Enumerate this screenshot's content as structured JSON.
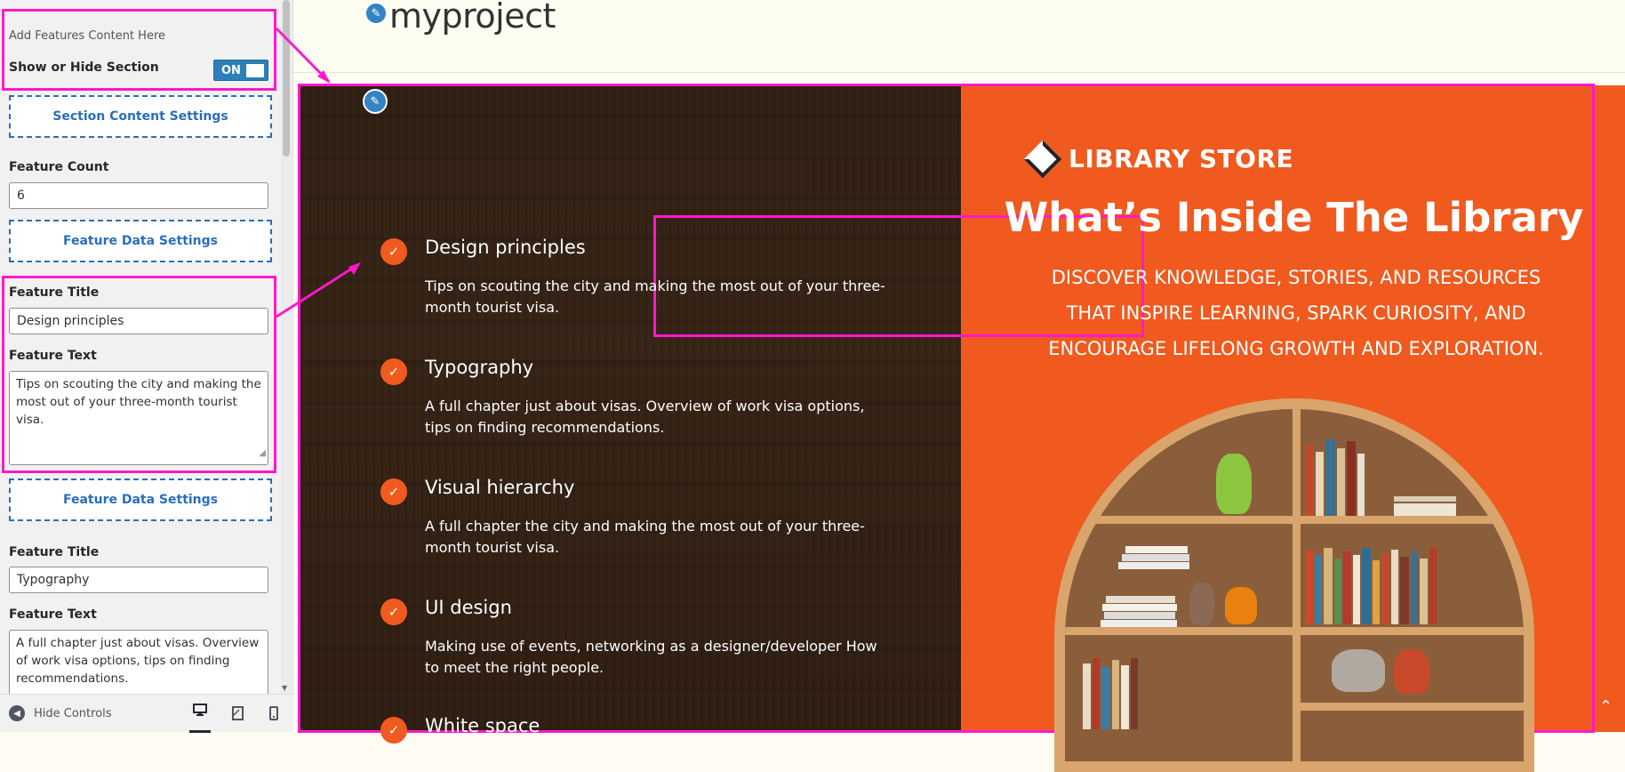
{
  "panel": {
    "intro_text": "Add Features Content Here",
    "toggle_label": "Show or Hide Section",
    "toggle_state": "ON",
    "section_content_button": "Section Content Settings",
    "feature_count_label": "Feature Count",
    "feature_count_value": "6",
    "feature_data_button": "Feature Data Settings",
    "features": [
      {
        "title_label": "Feature Title",
        "title_value": "Design principles",
        "text_label": "Feature Text",
        "text_value": "Tips on scouting the city and making the most out of your three-month tourist visa."
      },
      {
        "title_label": "Feature Title",
        "title_value": "Typography",
        "text_label": "Feature Text",
        "text_value": "A full chapter just about visas. Overview of work visa options, tips on finding recommendations."
      }
    ],
    "footer": {
      "hide_controls": "Hide Controls"
    }
  },
  "preview": {
    "site_title": "myproject",
    "brand_name": "LIBRARY STORE",
    "heading": "What’s Inside The Library",
    "subtext": "DISCOVER KNOWLEDGE, STORIES, AND RESOURCES THAT INSPIRE LEARNING, SPARK CURIOSITY, AND ENCOURAGE LIFELONG GROWTH AND EXPLORATION.",
    "features": [
      {
        "title": "Design principles",
        "text": "Tips on scouting the city and making the most out of your three-month tourist visa."
      },
      {
        "title": "Typography",
        "text": "A full chapter just about visas. Overview of work visa options, tips on finding recommendations."
      },
      {
        "title": "Visual hierarchy",
        "text": "A full chapter the city and making the most out of your three-month tourist visa."
      },
      {
        "title": "UI design",
        "text": "Making use of events, networking as a designer/developer How to meet the right people."
      },
      {
        "title": "White space",
        "text": ""
      }
    ]
  },
  "colors": {
    "accent_orange": "#f05a1e",
    "highlight_magenta": "#ff19c9",
    "customizer_blue": "#2a6ebb"
  },
  "icons": {
    "edit": "pencil-icon",
    "check": "check-icon",
    "hide_controls": "chevron-left-circle-icon",
    "desktop": "desktop-icon",
    "tablet": "tablet-icon",
    "mobile": "mobile-icon",
    "scroll_top": "chevron-up-icon"
  }
}
